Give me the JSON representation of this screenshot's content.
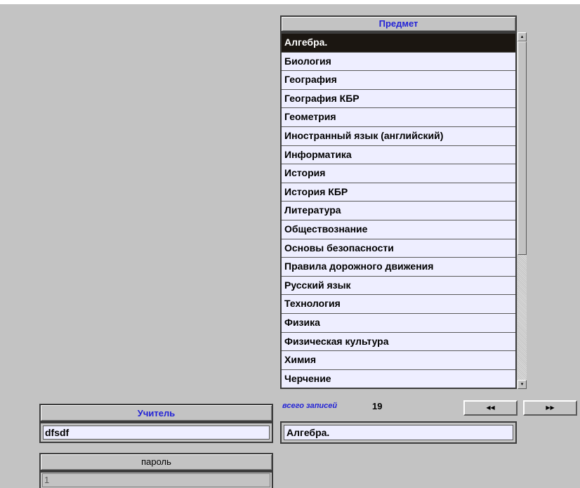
{
  "subjects": {
    "header": "Предмет",
    "selected_index": 0,
    "items": [
      "Алгебра.",
      "Биология",
      "География",
      "География КБР",
      "Геометрия",
      "Иностранный язык (английский)",
      "Информатика",
      "История",
      "История КБР",
      "Литература",
      "Обществознание",
      "Основы безопасности",
      "Правила дорожного движения",
      "Русский язык",
      "Технология",
      "Физика",
      "Физическая культура",
      "Химия",
      "Черчение"
    ]
  },
  "records": {
    "label": "всего записей",
    "count": "19"
  },
  "nav": {
    "prev_icon": "rewind-icon",
    "next_icon": "fast-forward-icon",
    "prev_glyph": "◀◀",
    "next_glyph": "▶▶"
  },
  "current_subject": "Алгебра.",
  "teacher": {
    "header": "Учитель",
    "value": "dfsdf"
  },
  "password": {
    "header": "пароль",
    "value": "1"
  },
  "colors": {
    "background": "#c3c3c3",
    "header_text": "#2323d6",
    "row_bg": "#eeeeff",
    "selected_bg": "#1b1611"
  }
}
